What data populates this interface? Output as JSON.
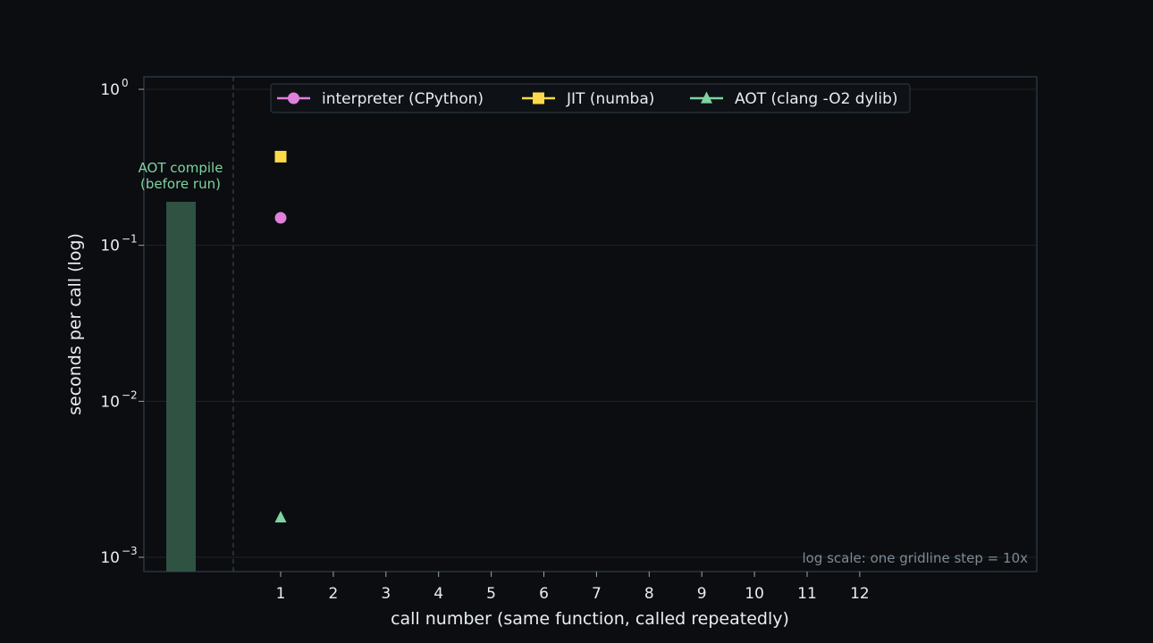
{
  "chart_data": {
    "type": "scatter",
    "title": "",
    "xlabel": "call number (same function, called repeatedly)",
    "ylabel": "seconds per call (log)",
    "yscale": "log",
    "ylim": [
      0.0008,
      1.2
    ],
    "xticks": [
      "1",
      "2",
      "3",
      "4",
      "5",
      "6",
      "7",
      "8",
      "9",
      "10",
      "11",
      "12"
    ],
    "yticks": [
      {
        "value": 1,
        "base": "10",
        "exp": "0"
      },
      {
        "value": 0.1,
        "base": "10",
        "exp": "−1"
      },
      {
        "value": 0.01,
        "base": "10",
        "exp": "−2"
      },
      {
        "value": 0.001,
        "base": "10",
        "exp": "−3"
      }
    ],
    "grid": true,
    "legend_position": "top-center",
    "series": [
      {
        "name": "interpreter (CPython)",
        "marker": "circle",
        "color": "#e07fdc",
        "x": [
          1
        ],
        "y": [
          0.15
        ]
      },
      {
        "name": "JIT (numba)",
        "marker": "square",
        "color": "#fdd94a",
        "x": [
          1
        ],
        "y": [
          0.37
        ]
      },
      {
        "name": "AOT (clang -O2 dylib)",
        "marker": "triangle",
        "color": "#7fd3a0",
        "x": [
          1
        ],
        "y": [
          0.0018
        ]
      }
    ],
    "compile_bar": {
      "label_line1": "AOT compile",
      "label_line2": "(before run)",
      "value": 0.19,
      "color": "#2f5242",
      "label_color": "#7fd3a0"
    },
    "annotation": "log scale: one gridline step = 10x",
    "colors": {
      "background": "#0b0d10",
      "plot_border": "#2a343d",
      "grid": "#1f2429",
      "text": "#e8edf2",
      "annotation": "#7d8a94"
    }
  }
}
